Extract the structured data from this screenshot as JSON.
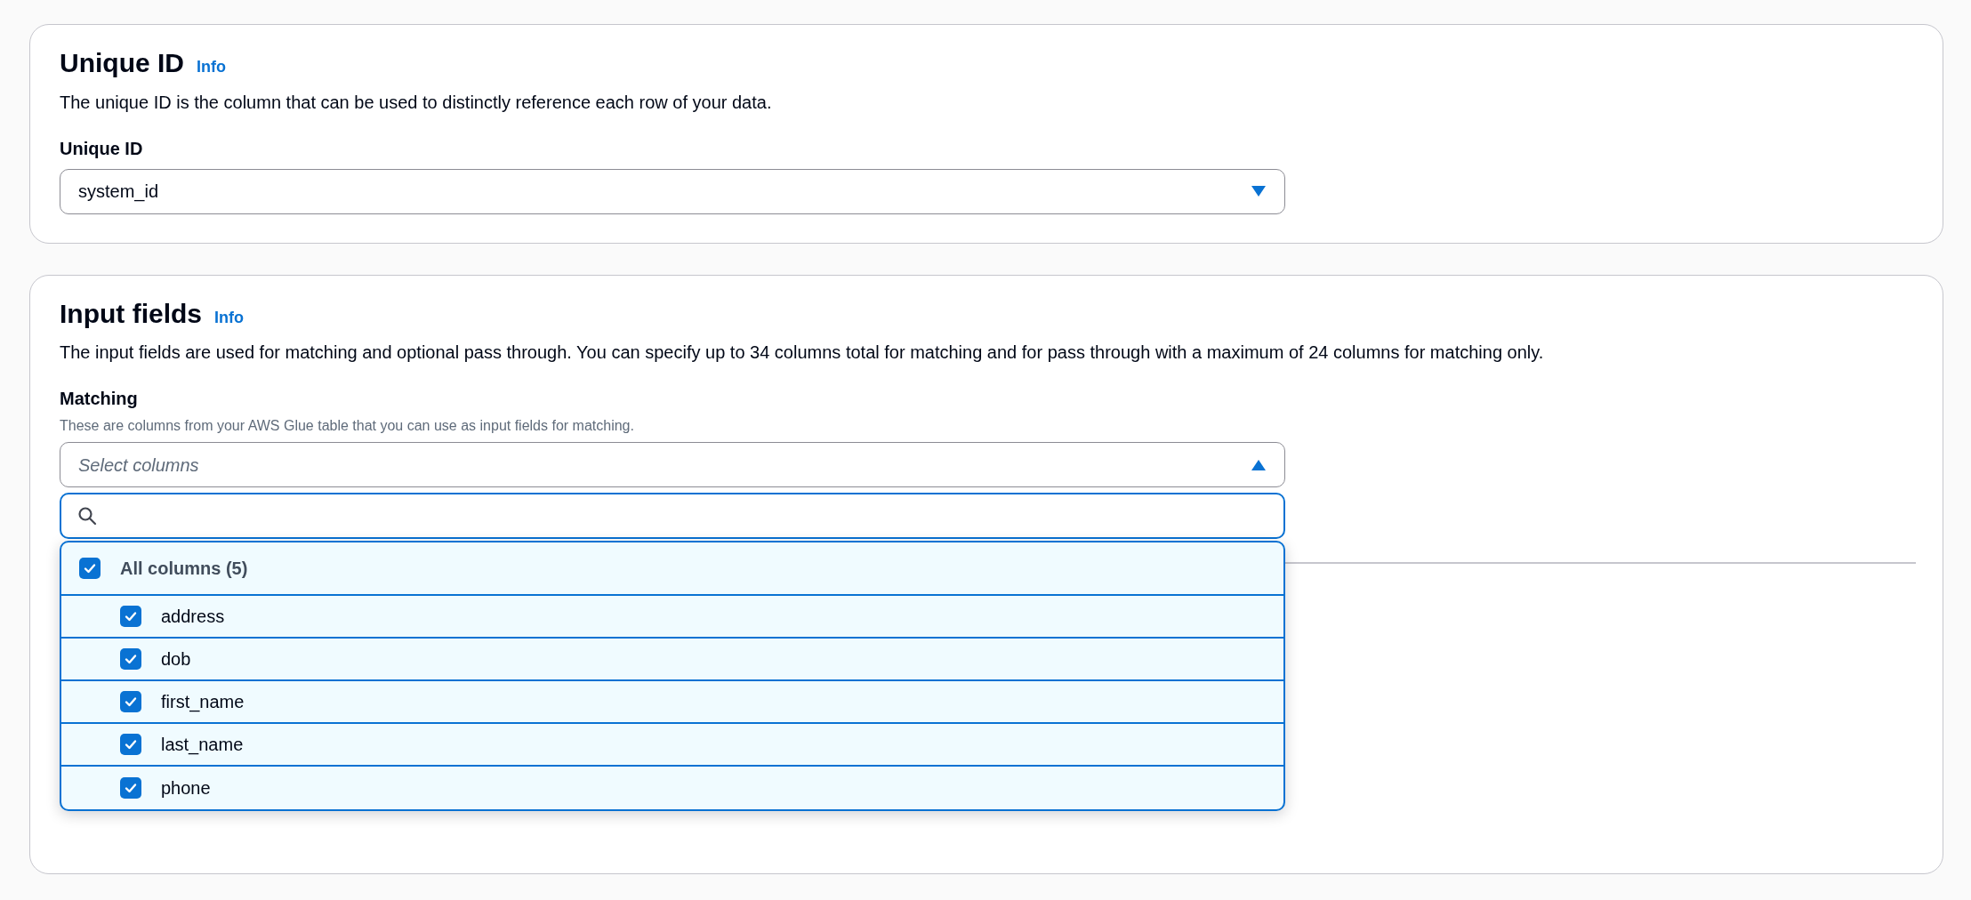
{
  "unique_id_section": {
    "title": "Unique ID",
    "info": "Info",
    "description": "The unique ID is the column that can be used to distinctly reference each row of your data.",
    "field_label": "Unique ID",
    "select": {
      "value": "system_id",
      "expanded": false
    }
  },
  "input_fields_section": {
    "title": "Input fields",
    "info": "Info",
    "description": "The input fields are used for matching and optional pass through. You can specify up to 34 columns total for matching and for pass through with a maximum of 24 columns for matching only.",
    "matching": {
      "label": "Matching",
      "hint": "These are columns from your AWS Glue table that you can use as input fields for matching.",
      "select": {
        "placeholder": "Select columns",
        "expanded": true
      },
      "dropdown": {
        "all_option": {
          "label": "All columns (5)",
          "checked": true
        },
        "options": [
          {
            "label": "address",
            "checked": true
          },
          {
            "label": "dob",
            "checked": true
          },
          {
            "label": "first_name",
            "checked": true
          },
          {
            "label": "last_name",
            "checked": true
          },
          {
            "label": "phone",
            "checked": true
          }
        ]
      }
    }
  }
}
